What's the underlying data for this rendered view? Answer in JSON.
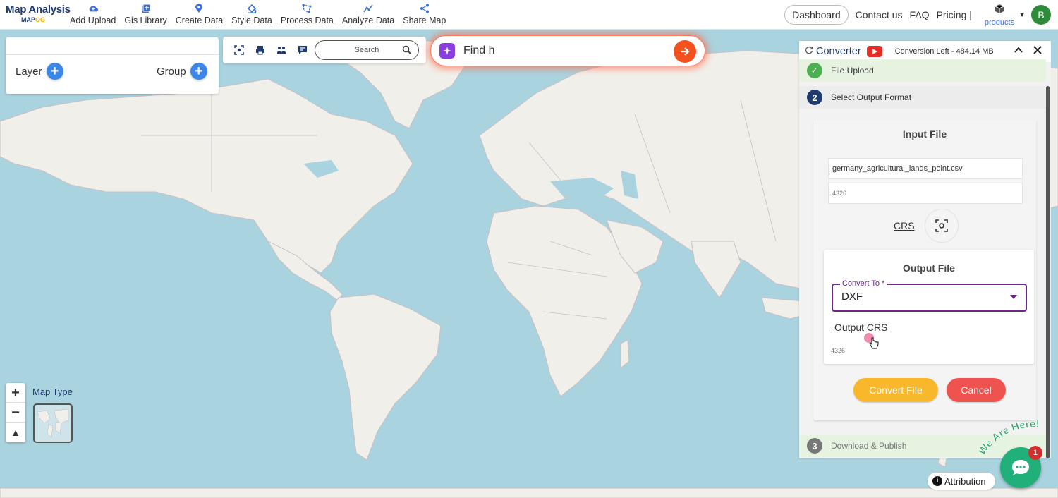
{
  "brand": {
    "line1": "Map Analysis",
    "line2_a": "MAP",
    "line2_b": "OG"
  },
  "nav": [
    {
      "label": "Add Upload",
      "icon": "cloud-upload-icon"
    },
    {
      "label": "Gis Library",
      "icon": "library-icon"
    },
    {
      "label": "Create Data",
      "icon": "location-pin-icon"
    },
    {
      "label": "Style Data",
      "icon": "paint-bucket-icon"
    },
    {
      "label": "Process Data",
      "icon": "process-icon"
    },
    {
      "label": "Analyze Data",
      "icon": "analyze-icon"
    },
    {
      "label": "Share Map",
      "icon": "share-icon"
    }
  ],
  "top_right": {
    "dashboard": "Dashboard",
    "contact": "Contact us",
    "faq": "FAQ",
    "pricing": "Pricing |",
    "products": "products",
    "avatar": "B"
  },
  "layer_panel": {
    "layer": "Layer",
    "group": "Group"
  },
  "toolbar": {
    "search_placeholder": "Search"
  },
  "find": {
    "text": "Find h"
  },
  "map_controls": {
    "zoom_in": "+",
    "zoom_out": "−",
    "reset": "▲",
    "map_type": "Map Type"
  },
  "converter": {
    "title": "Converter",
    "conversion_left": "Conversion Left - 484.14 MB",
    "steps": [
      {
        "num": "✓",
        "label": "File Upload"
      },
      {
        "num": "2",
        "label": "Select Output Format"
      },
      {
        "num": "3",
        "label": "Download & Publish"
      }
    ],
    "input": {
      "title": "Input File",
      "filename": "germany_agricultural_lands_point.csv",
      "crs_value": "4326",
      "crs_label": "CRS"
    },
    "output": {
      "title": "Output File",
      "convert_to_label": "Convert To *",
      "convert_to_value": "DXF",
      "output_crs_label": "Output CRS",
      "output_crs_value": "4326"
    },
    "buttons": {
      "convert": "Convert File",
      "cancel": "Cancel"
    }
  },
  "attribution": "Attribution",
  "chat": {
    "badge": "1",
    "we_are_here": "We Are Here!"
  },
  "colors": {
    "accent": "#6b2a8a",
    "convert": "#f9b82c",
    "cancel": "#ef5350",
    "ocean": "#a9d3df",
    "land": "#f1efe9"
  }
}
